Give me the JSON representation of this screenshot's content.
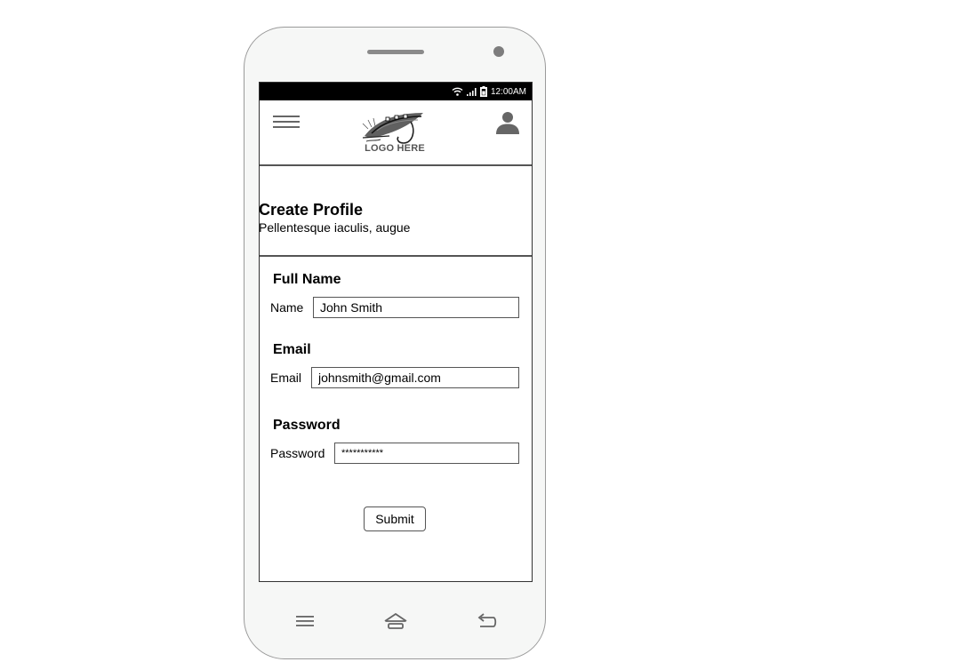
{
  "status_bar": {
    "time": "12:00AM",
    "icons": [
      "wifi-icon",
      "signal-icon",
      "battery-icon"
    ]
  },
  "header": {
    "logo_text": "LOGO HERE",
    "menu_icon": "hamburger-menu-icon",
    "profile_icon": "user-icon"
  },
  "title": {
    "heading": "Create Profile",
    "subtitle": "Pellentesque iaculis, augue"
  },
  "form": {
    "full_name": {
      "heading": "Full Name",
      "label": "Name",
      "value": "John Smith"
    },
    "email": {
      "heading": "Email",
      "label": "Email",
      "value": "johnsmith@gmail.com"
    },
    "password": {
      "heading": "Password",
      "label": "Password",
      "value": "***********"
    },
    "submit_label": "Submit"
  },
  "nav_bar": {
    "icons": [
      "menu-lines-icon",
      "home-icon",
      "back-icon"
    ]
  },
  "colors": {
    "status_bar_bg": "#000000",
    "phone_body": "#f6f7f6",
    "icon_gray": "#666666"
  }
}
